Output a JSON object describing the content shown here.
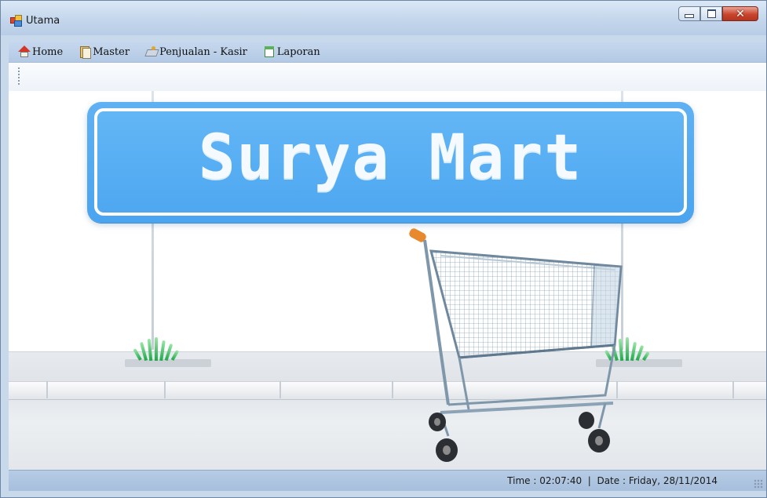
{
  "window": {
    "title": "Utama",
    "controls": [
      "minimize",
      "maximize",
      "close"
    ]
  },
  "menu": {
    "items": [
      {
        "label": "Home",
        "icon": "home-icon"
      },
      {
        "label": "Master",
        "icon": "folder-icon"
      },
      {
        "label": "Penjualan - Kasir",
        "icon": "cashier-icon"
      },
      {
        "label": "Laporan",
        "icon": "report-icon"
      }
    ]
  },
  "banner": {
    "sign_text": "Surya Mart",
    "sign_color": "#5aaff2"
  },
  "status": {
    "time_label": "Time :",
    "time": "02:07:40",
    "separator": "|",
    "date_label": "Date :",
    "date": "Friday, 28/11/2014"
  }
}
